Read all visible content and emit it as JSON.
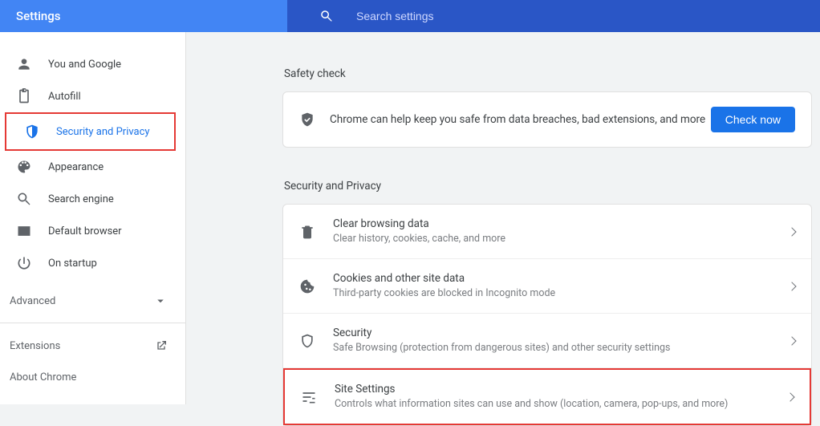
{
  "header": {
    "title": "Settings",
    "search_placeholder": "Search settings"
  },
  "sidebar": {
    "items": [
      {
        "id": "you-and-google",
        "label": "You and Google"
      },
      {
        "id": "autofill",
        "label": "Autofill"
      },
      {
        "id": "security-and-privacy",
        "label": "Security and Privacy",
        "active": true
      },
      {
        "id": "appearance",
        "label": "Appearance"
      },
      {
        "id": "search-engine",
        "label": "Search engine"
      },
      {
        "id": "default-browser",
        "label": "Default browser"
      },
      {
        "id": "on-startup",
        "label": "On startup"
      }
    ],
    "advanced_label": "Advanced",
    "extensions_label": "Extensions",
    "about_label": "About Chrome"
  },
  "main": {
    "safety": {
      "heading": "Safety check",
      "text": "Chrome can help keep you safe from data breaches, bad extensions, and more",
      "button": "Check now"
    },
    "security_and_privacy": {
      "heading": "Security and Privacy",
      "rows": [
        {
          "id": "clear-browsing-data",
          "title": "Clear browsing data",
          "desc": "Clear history, cookies, cache, and more"
        },
        {
          "id": "cookies",
          "title": "Cookies and other site data",
          "desc": "Third-party cookies are blocked in Incognito mode"
        },
        {
          "id": "security",
          "title": "Security",
          "desc": "Safe Browsing (protection from dangerous sites) and other security settings"
        },
        {
          "id": "site-settings",
          "title": "Site Settings",
          "desc": "Controls what information sites can use and show (location, camera, pop-ups, and more)"
        }
      ]
    }
  }
}
